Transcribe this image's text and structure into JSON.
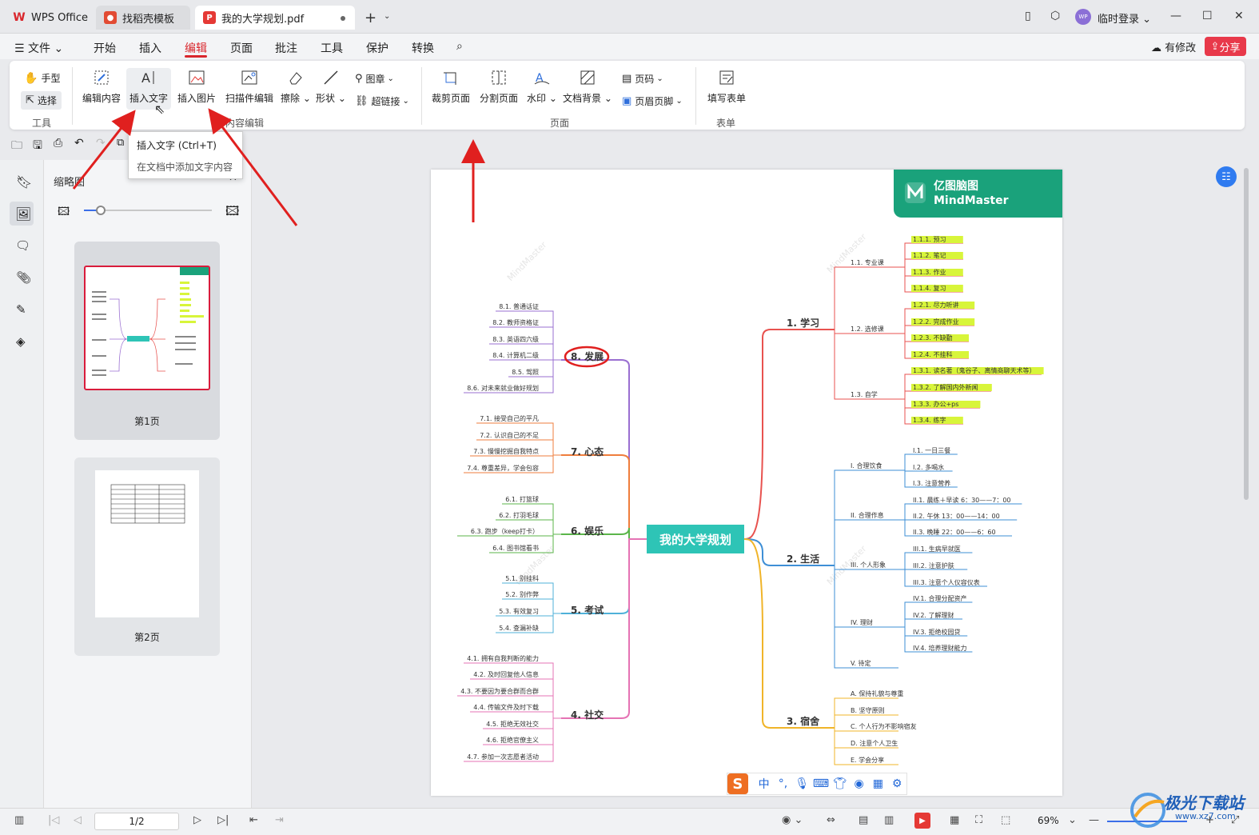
{
  "tabs": [
    {
      "label": "WPS Office",
      "icon": "wps-logo-icon"
    },
    {
      "label": "找稻壳模板",
      "icon": "docer-icon"
    },
    {
      "label": "我的大学规划.pdf",
      "icon": "pdf-icon"
    }
  ],
  "titlebar": {
    "login": "临时登录",
    "avatar_text": "WP"
  },
  "menu": {
    "file": "文件",
    "items": [
      "开始",
      "插入",
      "编辑",
      "页面",
      "批注",
      "工具",
      "保护",
      "转换"
    ],
    "active": "编辑",
    "modified": "有修改",
    "share": "分享"
  },
  "ribbon": {
    "tools": {
      "hand": "手型",
      "select": "选择",
      "group": "工具"
    },
    "edit_content": "编辑内容",
    "insert_text": "插入文字",
    "insert_image": "插入图片",
    "scan_edit": "扫描件编辑",
    "erase": "擦除",
    "shape": "形状",
    "stamp": "图章",
    "hyperlink": "超链接",
    "group_content": "内容编辑",
    "crop_page": "裁剪页面",
    "split_page": "分割页面",
    "watermark": "水印",
    "doc_background": "文档背景",
    "page_number": "页码",
    "header_footer": "页眉页脚",
    "group_page": "页面",
    "fill_form": "填写表单",
    "group_form": "表单"
  },
  "tooltip": {
    "title": "插入文字 (Ctrl+T)",
    "desc": "在文档中添加文字内容"
  },
  "thumbnail_panel": {
    "title": "缩略图",
    "pages": [
      "第1页",
      "第2页"
    ]
  },
  "document": {
    "brand_cn": "亿图脑图",
    "brand_en": "MindMaster",
    "center": "我的大学规划",
    "right_branches": [
      {
        "label": "1. 学习",
        "color": "#e8524f",
        "subs": [
          {
            "label": "1.1. 专业课",
            "leaves": [
              "1.1.1. 预习",
              "1.1.2. 笔记",
              "1.1.3. 作业",
              "1.1.4. 复习"
            ]
          },
          {
            "label": "1.2. 选修课",
            "leaves": [
              "1.2.1. 尽力听讲",
              "1.2.2. 完成作业",
              "1.2.3. 不缺勤",
              "1.2.4. 不挂科"
            ]
          },
          {
            "label": "1.3. 自学",
            "leaves": [
              "1.3.1. 读名著（鬼谷子、离情商聊天术等）",
              "1.3.2. 了解国内外新闻",
              "1.3.3. 办公+ps",
              "1.3.4. 练字"
            ]
          }
        ]
      },
      {
        "label": "2. 生活",
        "color": "#3e8fd6",
        "subs": [
          {
            "label": "I. 合理饮食",
            "leaves": [
              "I.1. 一日三餐",
              "I.2. 多喝水",
              "I.3. 注意营养"
            ]
          },
          {
            "label": "II. 合理作息",
            "leaves": [
              "II.1. 晨练＋早读 6：30——7：00",
              "II.2. 午休 13：00——14：00",
              "II.3. 晚睡 22：00——6：60"
            ]
          },
          {
            "label": "III. 个人形象",
            "leaves": [
              "III.1. 生病早就医",
              "III.2. 注意护肤",
              "III.3. 注意个人仪容仪表"
            ]
          },
          {
            "label": "IV. 理财",
            "leaves": [
              "IV.1. 合理分配资产",
              "IV.2. 了解理财",
              "IV.3. 拒绝校园贷",
              "IV.4. 培养理财能力"
            ]
          },
          {
            "label": "V. 待定",
            "leaves": []
          }
        ]
      },
      {
        "label": "3. 宿舍",
        "color": "#f0b429",
        "subs": [
          {
            "label": "A. 保持礼貌与尊重",
            "leaves": []
          },
          {
            "label": "B. 坚守原则",
            "leaves": []
          },
          {
            "label": "C. 个人行为不影响宿友",
            "leaves": []
          },
          {
            "label": "D. 注意个人卫生",
            "leaves": []
          },
          {
            "label": "E. 学会分享",
            "leaves": []
          }
        ]
      }
    ],
    "left_branches": [
      {
        "label": "8. 发展",
        "color": "#9a6fd1",
        "leaves": [
          "8.1. 普通话证",
          "8.2. 教师资格证",
          "8.3. 英语四六级",
          "8.4. 计算机二级",
          "8.5. 驾照",
          "8.6. 对未来就业做好规划"
        ]
      },
      {
        "label": "7. 心态",
        "color": "#ef7d3c",
        "leaves": [
          "7.1. 接受自己的平凡",
          "7.2. 认识自己的不足",
          "7.3. 慢慢挖掘自我特点",
          "7.4. 尊重差异，学会包容"
        ]
      },
      {
        "label": "6. 娱乐",
        "color": "#5bb54a",
        "leaves": [
          "6.1. 打篮球",
          "6.2. 打羽毛球",
          "6.3. 跑步（keep打卡）",
          "6.4. 图书馆看书"
        ]
      },
      {
        "label": "5. 考试",
        "color": "#4fb1d9",
        "leaves": [
          "5.1. 别挂科",
          "5.2. 别作弊",
          "5.3. 有效复习",
          "5.4. 查漏补缺"
        ]
      },
      {
        "label": "4. 社交",
        "color": "#e573b4",
        "leaves": [
          "4.1. 拥有自我判断的能力",
          "4.2. 及时回复他人信息",
          "4.3. 不要因为要合群而合群",
          "4.4. 传输文件及时下载",
          "4.5. 拒绝无效社交",
          "4.6. 拒绝官僚主义",
          "4.7. 参加一次志愿者活动"
        ]
      }
    ]
  },
  "ime": {
    "lang": "中"
  },
  "statusbar": {
    "page": "1/2",
    "zoom": "69%",
    "site_cn": "极光下载站",
    "site_url": "www.xz7.com"
  },
  "colors": {
    "accent": "#d9262c",
    "center": "#2ec4b6",
    "highlight": "#d8f53a",
    "annotation": "#e0201f"
  }
}
